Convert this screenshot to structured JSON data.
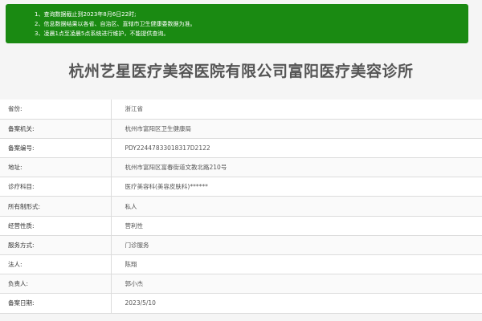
{
  "notice": {
    "lines": [
      "1、查询数据截止到2023年8月6日22时;",
      "2、信息数据结果以各省、自治区、直辖市卫生健康委数据为准。",
      "3、凌晨1点至凌晨5点系统进行维护，不能提供查询。"
    ]
  },
  "title": "杭州艺星医疗美容医院有限公司富阳医疗美容诊所",
  "rows": [
    {
      "label": "省份:",
      "value": "浙江省"
    },
    {
      "label": "备案机关:",
      "value": "杭州市富阳区卫生健康局"
    },
    {
      "label": "备案编号:",
      "value": "PDY22447833018317D2122"
    },
    {
      "label": "地址:",
      "value": "杭州市富阳区富春街道文教北路210号"
    },
    {
      "label": "诊疗科目:",
      "value": "医疗美容科(美容皮肤科)******"
    },
    {
      "label": "所有制形式:",
      "value": "私人"
    },
    {
      "label": "经营性质:",
      "value": "营利性"
    },
    {
      "label": "服务方式:",
      "value": "门诊服务"
    },
    {
      "label": "法人:",
      "value": "陈翔"
    },
    {
      "label": "负责人:",
      "value": "郭小杰"
    },
    {
      "label": "备案日期:",
      "value": "2023/5/10"
    }
  ]
}
